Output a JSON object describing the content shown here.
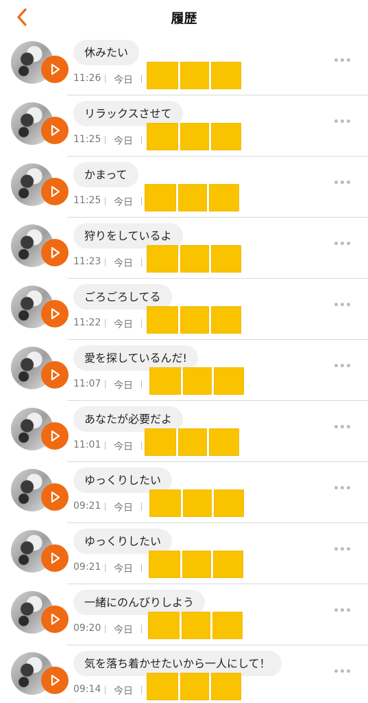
{
  "header": {
    "title": "履歴",
    "back_icon": "chevron-left-icon",
    "accent_color": "#ef6a12"
  },
  "rows": [
    {
      "text": "休みたい",
      "time": "11:26",
      "day": "今日"
    },
    {
      "text": "リラックスさせて",
      "time": "11:25",
      "day": "今日"
    },
    {
      "text": "かまって",
      "time": "11:25",
      "day": "今日"
    },
    {
      "text": "狩りをしているよ",
      "time": "11:23",
      "day": "今日"
    },
    {
      "text": "ごろごろしてる",
      "time": "11:22",
      "day": "今日"
    },
    {
      "text": "愛を探しているんだ!",
      "time": "11:07",
      "day": "今日"
    },
    {
      "text": "あなたが必要だよ",
      "time": "11:01",
      "day": "今日"
    },
    {
      "text": "ゆっくりしたい",
      "time": "09:21",
      "day": "今日"
    },
    {
      "text": "ゆっくりしたい",
      "time": "09:21",
      "day": "今日"
    },
    {
      "text": "一緒にのんびりしよう",
      "time": "09:20",
      "day": "今日"
    },
    {
      "text": "気を落ち着かせたいから一人にして！",
      "time": "09:14",
      "day": "今日"
    }
  ],
  "icons": {
    "play": "play-icon",
    "more": "more-dots-icon",
    "avatar": "cat-avatar"
  },
  "redaction_color": "#f9c300"
}
